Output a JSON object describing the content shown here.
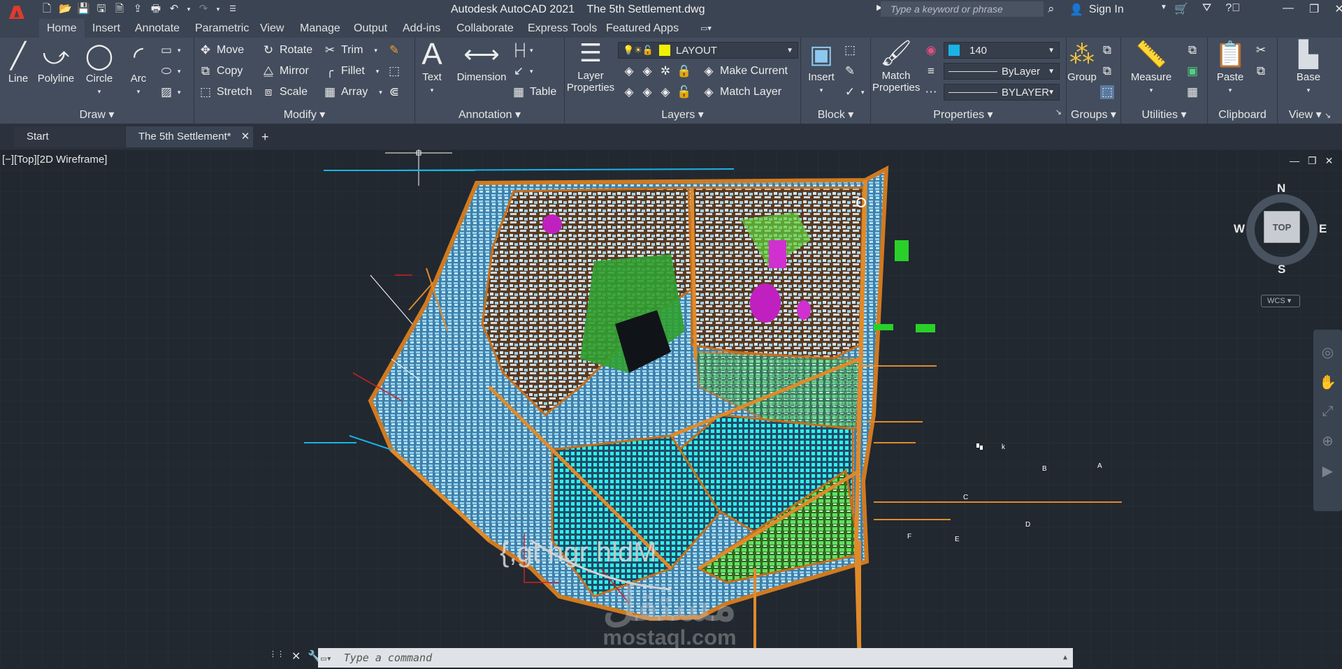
{
  "app": {
    "logo": "A",
    "title": "Autodesk AutoCAD 2021    The 5th Settlement.dwg",
    "search_placeholder": "Type a keyword or phrase",
    "sign_in": "Sign In"
  },
  "menu_tabs": [
    "Home",
    "Insert",
    "Annotate",
    "Parametric",
    "View",
    "Manage",
    "Output",
    "Add-ins",
    "Collaborate",
    "Express Tools",
    "Featured Apps"
  ],
  "ribbon": {
    "draw": {
      "title": "Draw",
      "line": "Line",
      "polyline": "Polyline",
      "circle": "Circle",
      "arc": "Arc"
    },
    "modify": {
      "title": "Modify",
      "move": "Move",
      "rotate": "Rotate",
      "trim": "Trim",
      "copy": "Copy",
      "mirror": "Mirror",
      "fillet": "Fillet",
      "stretch": "Stretch",
      "scale": "Scale",
      "array": "Array"
    },
    "annotation": {
      "title": "Annotation",
      "text": "Text",
      "dimension": "Dimension",
      "table": "Table"
    },
    "layers": {
      "title": "Layers",
      "layer_properties_1": "Layer",
      "layer_properties_2": "Properties",
      "current_layer": "LAYOUT",
      "make_current": "Make Current",
      "match_layer": "Match Layer",
      "layer_color": "#f0f000"
    },
    "block": {
      "title": "Block",
      "insert": "Insert"
    },
    "properties": {
      "title": "Properties",
      "match_1": "Match",
      "match_2": "Properties",
      "color_value": "140",
      "color_swatch": "#1ab3e6",
      "linetype": "ByLayer",
      "lineweight": "BYLAYER"
    },
    "groups": {
      "title": "Groups",
      "group": "Group"
    },
    "utilities": {
      "title": "Utilities",
      "measure": "Measure"
    },
    "clipboard": {
      "title": "Clipboard",
      "paste": "Paste"
    },
    "view": {
      "title": "View",
      "base": "Base"
    }
  },
  "doc_tabs": {
    "start": "Start",
    "current": "The 5th Settlement*",
    "close": "✕",
    "add": "+"
  },
  "viewport": {
    "label": "[−][Top][2D Wireframe]",
    "viewcube": {
      "n": "N",
      "s": "S",
      "e": "E",
      "w": "W",
      "top": "TOP",
      "wcs": "WCS"
    },
    "drawing_text": "{,gt  hgr hldM",
    "point_labels": [
      "k",
      "B",
      "A",
      "C",
      "D",
      "F",
      "E"
    ]
  },
  "command": {
    "placeholder": "Type a command"
  },
  "watermark": {
    "arabic": "مستقل",
    "latin": "mostaql.com"
  }
}
